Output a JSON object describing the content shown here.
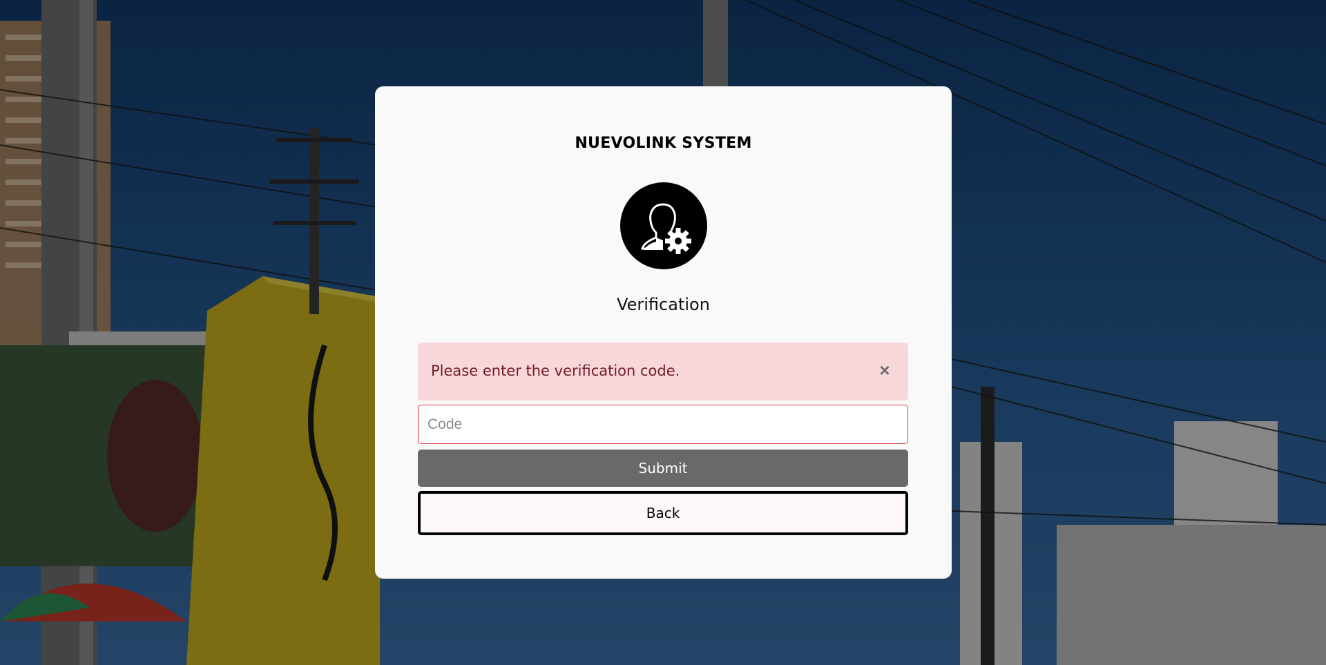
{
  "app": {
    "title": "NUEVOLINK SYSTEM"
  },
  "page": {
    "heading": "Verification",
    "icon": "user-gear-icon"
  },
  "alert": {
    "message": "Please enter the verification code.",
    "close_label": "×",
    "type": "danger"
  },
  "form": {
    "code": {
      "value": "",
      "placeholder": "Code"
    },
    "submit_label": "Submit",
    "back_label": "Back"
  },
  "colors": {
    "card_background": "#f9f9f9",
    "alert_background": "#f8d7da",
    "alert_text": "#721c24",
    "input_border_error": "#dc3545",
    "submit_background": "#696969",
    "back_border": "#000000",
    "sky": "#1f4e84",
    "box_yellow": "#d6c12a"
  }
}
